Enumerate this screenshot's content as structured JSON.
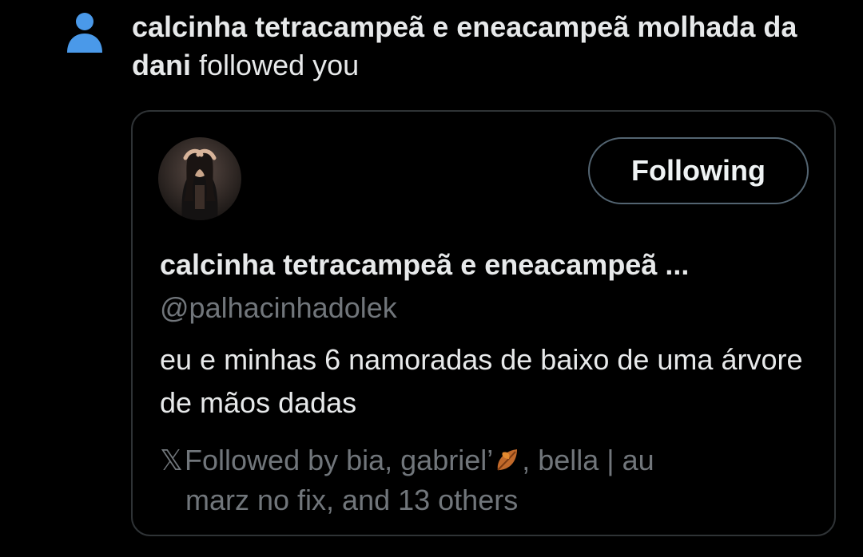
{
  "notification": {
    "actor_name": "calcinha tetracampeã e eneacampeã molhada da dani",
    "action_text": "followed you"
  },
  "card": {
    "display_name": "calcinha tetracampeã e eneacampeã ...",
    "handle": "@palhacinhadolek",
    "bio": "eu e minhas 6 namoradas de baixo de uma árvore de mãos dadas",
    "follow_button_label": "Following",
    "followed_by": {
      "icon": "x-logo-icon",
      "prefix": "Followed by bia, gabriel’",
      "emoji": "fallen-leaf-icon",
      "suffix": ", bella | au",
      "line2": "marz no fix, and 13 others"
    }
  },
  "colors": {
    "background": "#000000",
    "person_icon": "#1d9bf0",
    "primary_text": "#e7e9ea",
    "secondary_text": "#71767b",
    "card_border": "#2f3336"
  }
}
